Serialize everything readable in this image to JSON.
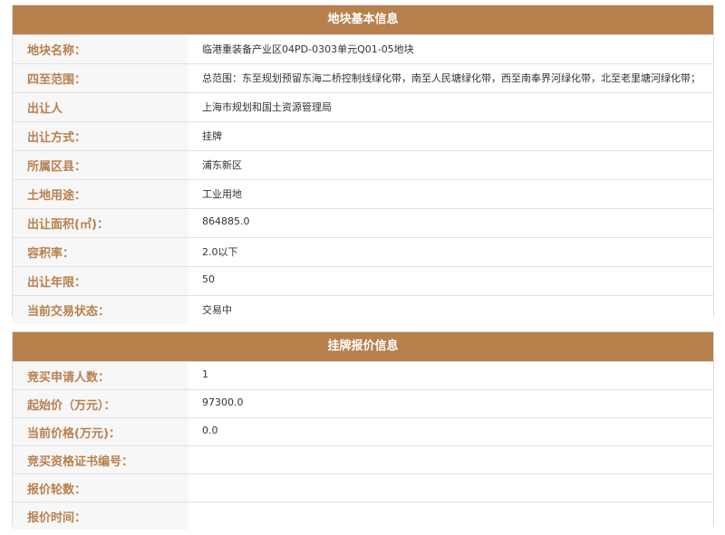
{
  "parcel_info": {
    "title": "地块基本信息",
    "rows": [
      {
        "label": "地块名称：",
        "value": "临港重装备产业区04PD-0303单元Q01-05地块"
      },
      {
        "label": "四至范围：",
        "value": "总范围：东至规划预留东海二桥控制线绿化带，南至人民塘绿化带，西至南奉界河绿化带，北至老里塘河绿化带；"
      },
      {
        "label": "出让人",
        "value": "上海市规划和国土资源管理局"
      },
      {
        "label": "出让方式：",
        "value": "挂牌"
      },
      {
        "label": "所属区县：",
        "value": "浦东新区"
      },
      {
        "label": "土地用途：",
        "value": "工业用地"
      },
      {
        "label": "出让面积(㎡)：",
        "value": "864885.0"
      },
      {
        "label": "容积率：",
        "value": "2.0以下"
      },
      {
        "label": "出让年限：",
        "value": "50"
      },
      {
        "label": "当前交易状态：",
        "value": "交易中"
      }
    ]
  },
  "listing_info": {
    "title": "挂牌报价信息",
    "rows": [
      {
        "label": "竞买申请人数：",
        "value": "1"
      },
      {
        "label": "起始价（万元）：",
        "value": "97300.0"
      },
      {
        "label": "当前价格(万元)：",
        "value": "0.0"
      },
      {
        "label": "竞买资格证书编号：",
        "value": ""
      },
      {
        "label": "报价轮数：",
        "value": ""
      },
      {
        "label": "报价时间：",
        "value": ""
      }
    ]
  },
  "colors": {
    "header_bg": "#b8804d",
    "label_text": "#b8804d",
    "label_bg": "#f7f7f7"
  }
}
